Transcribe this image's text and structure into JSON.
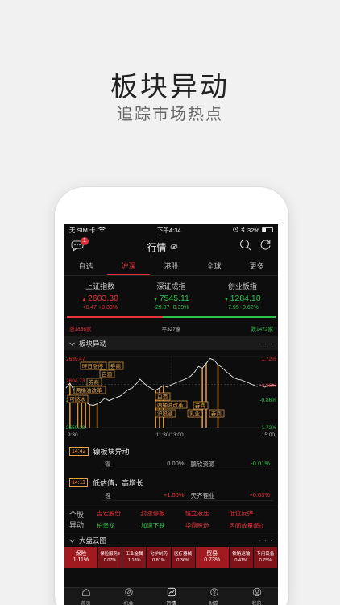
{
  "promo": {
    "title": "板块异动",
    "subtitle": "追踪市场热点"
  },
  "status_bar": {
    "carrier": "无 SIM 卡",
    "time": "下午4:34",
    "battery": "32%"
  },
  "nav": {
    "title": "行情",
    "message_badge": "1"
  },
  "tabs": [
    {
      "label": "自选"
    },
    {
      "label": "沪深"
    },
    {
      "label": "港股"
    },
    {
      "label": "全球"
    },
    {
      "label": "更多"
    }
  ],
  "active_tab": "沪深",
  "indices": [
    {
      "name": "上证指数",
      "price": "2603.30",
      "change": "+8.47",
      "pct": "+0.33%",
      "direction": "up"
    },
    {
      "name": "深证成指",
      "price": "7545.11",
      "change": "-29.87",
      "pct": "-0.39%",
      "direction": "down"
    },
    {
      "name": "创业板指",
      "price": "1284.10",
      "change": "-7.95",
      "pct": "-0.62%",
      "direction": "down"
    }
  ],
  "breadth": {
    "up_label": "涨1856家",
    "flat_label": "平327家",
    "down_label": "跌1472家",
    "up_fraction": 0.46
  },
  "board_move": {
    "title": "板块异动",
    "more": "· · ·"
  },
  "chart_data": {
    "type": "line",
    "y_left_ticks": [
      "2639.47",
      "2604.73",
      "2585.75",
      "2550.18"
    ],
    "y_right_ticks": [
      "1.72%",
      "0.86%",
      "-0.86%",
      "-1.72%"
    ],
    "x_ticks": [
      "9:30",
      "11:30/13:00",
      "15:00"
    ],
    "baseline": 2604.73,
    "ylim": [
      2550.18,
      2639.47
    ],
    "values": [
      2600,
      2606,
      2597,
      2590,
      2585,
      2582,
      2579,
      2578,
      2580,
      2583,
      2587,
      2584,
      2586,
      2588,
      2590,
      2594,
      2598,
      2600,
      2605,
      2611,
      2606,
      2602,
      2599,
      2597,
      2600,
      2603,
      2601,
      2604,
      2606,
      2608,
      2610,
      2612,
      2615,
      2620,
      2627,
      2625,
      2631,
      2637,
      2635,
      2629,
      2626,
      2621,
      2617,
      2613,
      2611,
      2610,
      2608,
      2606,
      2604,
      2602,
      2603,
      2601,
      2603,
      2604,
      2603
    ],
    "event_markers": [
      {
        "label": "昨日涨停",
        "index": 4
      },
      {
        "label": "券商",
        "index": 8
      },
      {
        "label": "白酒",
        "index": 6
      },
      {
        "label": "券商",
        "index": 3
      },
      {
        "label": "两桶油改革",
        "index": 5
      },
      {
        "label": "可燃冰",
        "index": 1
      },
      {
        "label": "白酒",
        "index": 23
      },
      {
        "label": "两桶油改革",
        "index": 24
      },
      {
        "label": "沪股通",
        "index": 25
      },
      {
        "label": "券商",
        "index": 35
      },
      {
        "label": "乳业",
        "index": 36
      },
      {
        "label": "券商",
        "index": 39
      }
    ]
  },
  "events": [
    {
      "time": "14:42",
      "title": "镍板块异动",
      "cells": [
        {
          "name": "镍",
          "value": "0.00%",
          "direction": "flat"
        },
        {
          "name": "鹏欣资源",
          "value": "-0.01%",
          "direction": "down"
        }
      ]
    },
    {
      "time": "14:11",
      "title": "低估值，高增长",
      "cells": [
        {
          "name": "锂",
          "value": "+1.00%",
          "direction": "up"
        },
        {
          "name": "天齐锂业",
          "value": "+0.03%",
          "direction": "up"
        }
      ]
    }
  ],
  "stock_moves": {
    "label_line1": "个股",
    "label_line2": "异动",
    "items": [
      {
        "name": "吉宏股份",
        "direction": "up"
      },
      {
        "name": "封涨停板",
        "direction": "up"
      },
      {
        "name": "恒立液压",
        "direction": "up"
      },
      {
        "name": "低位反弹",
        "direction": "up"
      },
      {
        "name": "柏堡龙",
        "direction": "down"
      },
      {
        "name": "加速下跌",
        "direction": "down"
      },
      {
        "name": "华鼎股份",
        "direction": "up"
      },
      {
        "name": "区间放量(跌)",
        "direction": "up"
      }
    ]
  },
  "cloud": {
    "title": "大盘云图",
    "more": "· · ·",
    "cells": [
      {
        "name": "保险",
        "pct": "1.11%",
        "big": true,
        "tone": "red"
      },
      {
        "name": "保险服务Ⅱ",
        "pct": "0.07%",
        "big": false,
        "tone": "red"
      },
      {
        "name": "工业金属",
        "pct": "1.18%",
        "big": false,
        "tone": "red"
      },
      {
        "name": "化学制药",
        "pct": "0.81%",
        "big": false,
        "tone": "red"
      },
      {
        "name": "医疗器械",
        "pct": "0.36%",
        "big": false,
        "tone": "red"
      },
      {
        "name": "贸易",
        "pct": "0.73%",
        "big": true,
        "tone": "red"
      },
      {
        "name": "铁路运输",
        "pct": "0.41%",
        "big": false,
        "tone": "red"
      },
      {
        "name": "专用设备",
        "pct": "0.75%",
        "big": false,
        "tone": "red"
      }
    ]
  },
  "bottom_tabs": [
    {
      "label": "首页",
      "icon": "home-icon"
    },
    {
      "label": "机会",
      "icon": "compass-icon"
    },
    {
      "label": "行情",
      "icon": "chart-icon"
    },
    {
      "label": "财富",
      "icon": "wallet-icon"
    },
    {
      "label": "我的",
      "icon": "user-icon"
    }
  ],
  "active_bottom_tab": "行情",
  "colors": {
    "up": "#e8333b",
    "down": "#2ec24d",
    "event": "#e8a34a",
    "background": "#0d0d0d"
  }
}
